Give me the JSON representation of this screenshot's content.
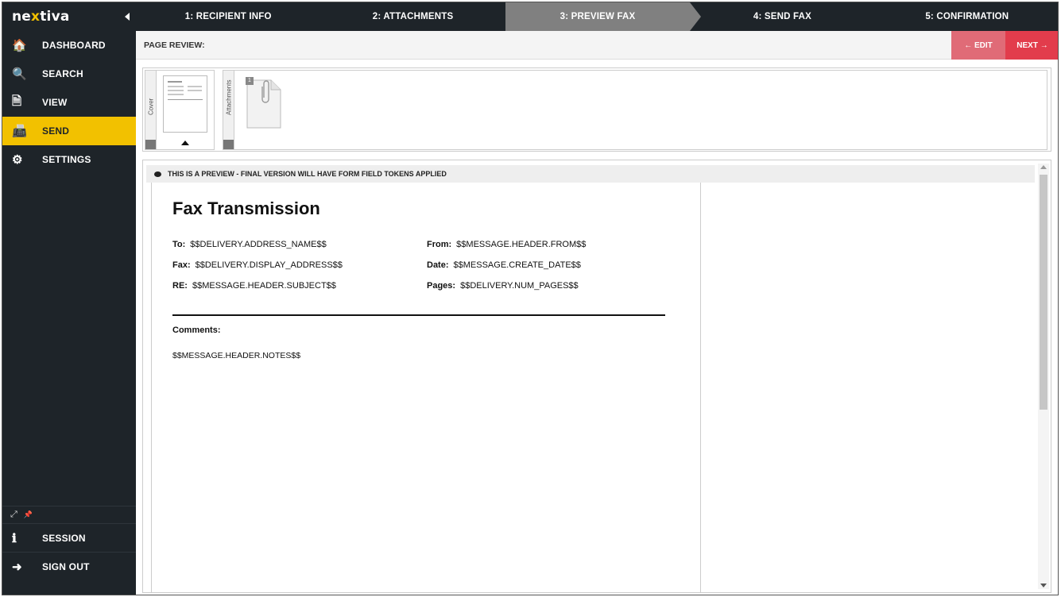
{
  "app": {
    "logo_text": "ne",
    "logo_accent": "x",
    "logo_rest": "tiva",
    "collapse_icon": "collapse-left-icon"
  },
  "sidebar": {
    "items": [
      {
        "label": "DASHBOARD",
        "icon": "home-icon",
        "glyph": "🏠"
      },
      {
        "label": "SEARCH",
        "icon": "search-icon",
        "glyph": "🔍"
      },
      {
        "label": "VIEW",
        "icon": "document-icon",
        "glyph": "🗎"
      },
      {
        "label": "SEND",
        "icon": "fax-icon",
        "glyph": "📠",
        "active": true
      },
      {
        "label": "SETTINGS",
        "icon": "gear-icon",
        "glyph": "⚙"
      }
    ],
    "tools": {
      "expand_glyph": "⤢",
      "pin_glyph": "📌"
    },
    "bottom_items": [
      {
        "label": "SESSION",
        "icon": "info-icon",
        "glyph": "ℹ"
      },
      {
        "label": "SIGN OUT",
        "icon": "sign-out-icon",
        "glyph": "➜"
      }
    ]
  },
  "steps": [
    {
      "label": "1: RECIPIENT INFO"
    },
    {
      "label": "2: ATTACHMENTS"
    },
    {
      "label": "3: PREVIEW FAX",
      "active": true
    },
    {
      "label": "4: SEND FAX"
    },
    {
      "label": "5: CONFIRMATION"
    }
  ],
  "review": {
    "title": "PAGE REVIEW:",
    "edit_label": "← EDIT",
    "next_label": "NEXT →"
  },
  "thumbnails": {
    "cover_tab": "Cover",
    "attachments_tab": "Attachments",
    "attachment_page_number": "1"
  },
  "preview": {
    "notice": "THIS IS A PREVIEW - FINAL VERSION WILL HAVE FORM FIELD TOKENS APPLIED",
    "doc_title": "Fax Transmission",
    "fields": {
      "to_label": "To:",
      "to_value": "$$DELIVERY.ADDRESS_NAME$$",
      "fax_label": "Fax:",
      "fax_value": "$$DELIVERY.DISPLAY_ADDRESS$$",
      "re_label": "RE:",
      "re_value": "$$MESSAGE.HEADER.SUBJECT$$",
      "from_label": "From:",
      "from_value": "$$MESSAGE.HEADER.FROM$$",
      "date_label": "Date:",
      "date_value": "$$MESSAGE.CREATE_DATE$$",
      "pages_label": "Pages:",
      "pages_value": "$$DELIVERY.NUM_PAGES$$"
    },
    "comments_label": "Comments:",
    "comments_value": "$$MESSAGE.HEADER.NOTES$$"
  },
  "colors": {
    "sidebar_bg": "#1e2429",
    "accent_yellow": "#f2c100",
    "edit_red": "#e06b77",
    "next_red": "#e23c4c",
    "active_step": "#808080"
  }
}
